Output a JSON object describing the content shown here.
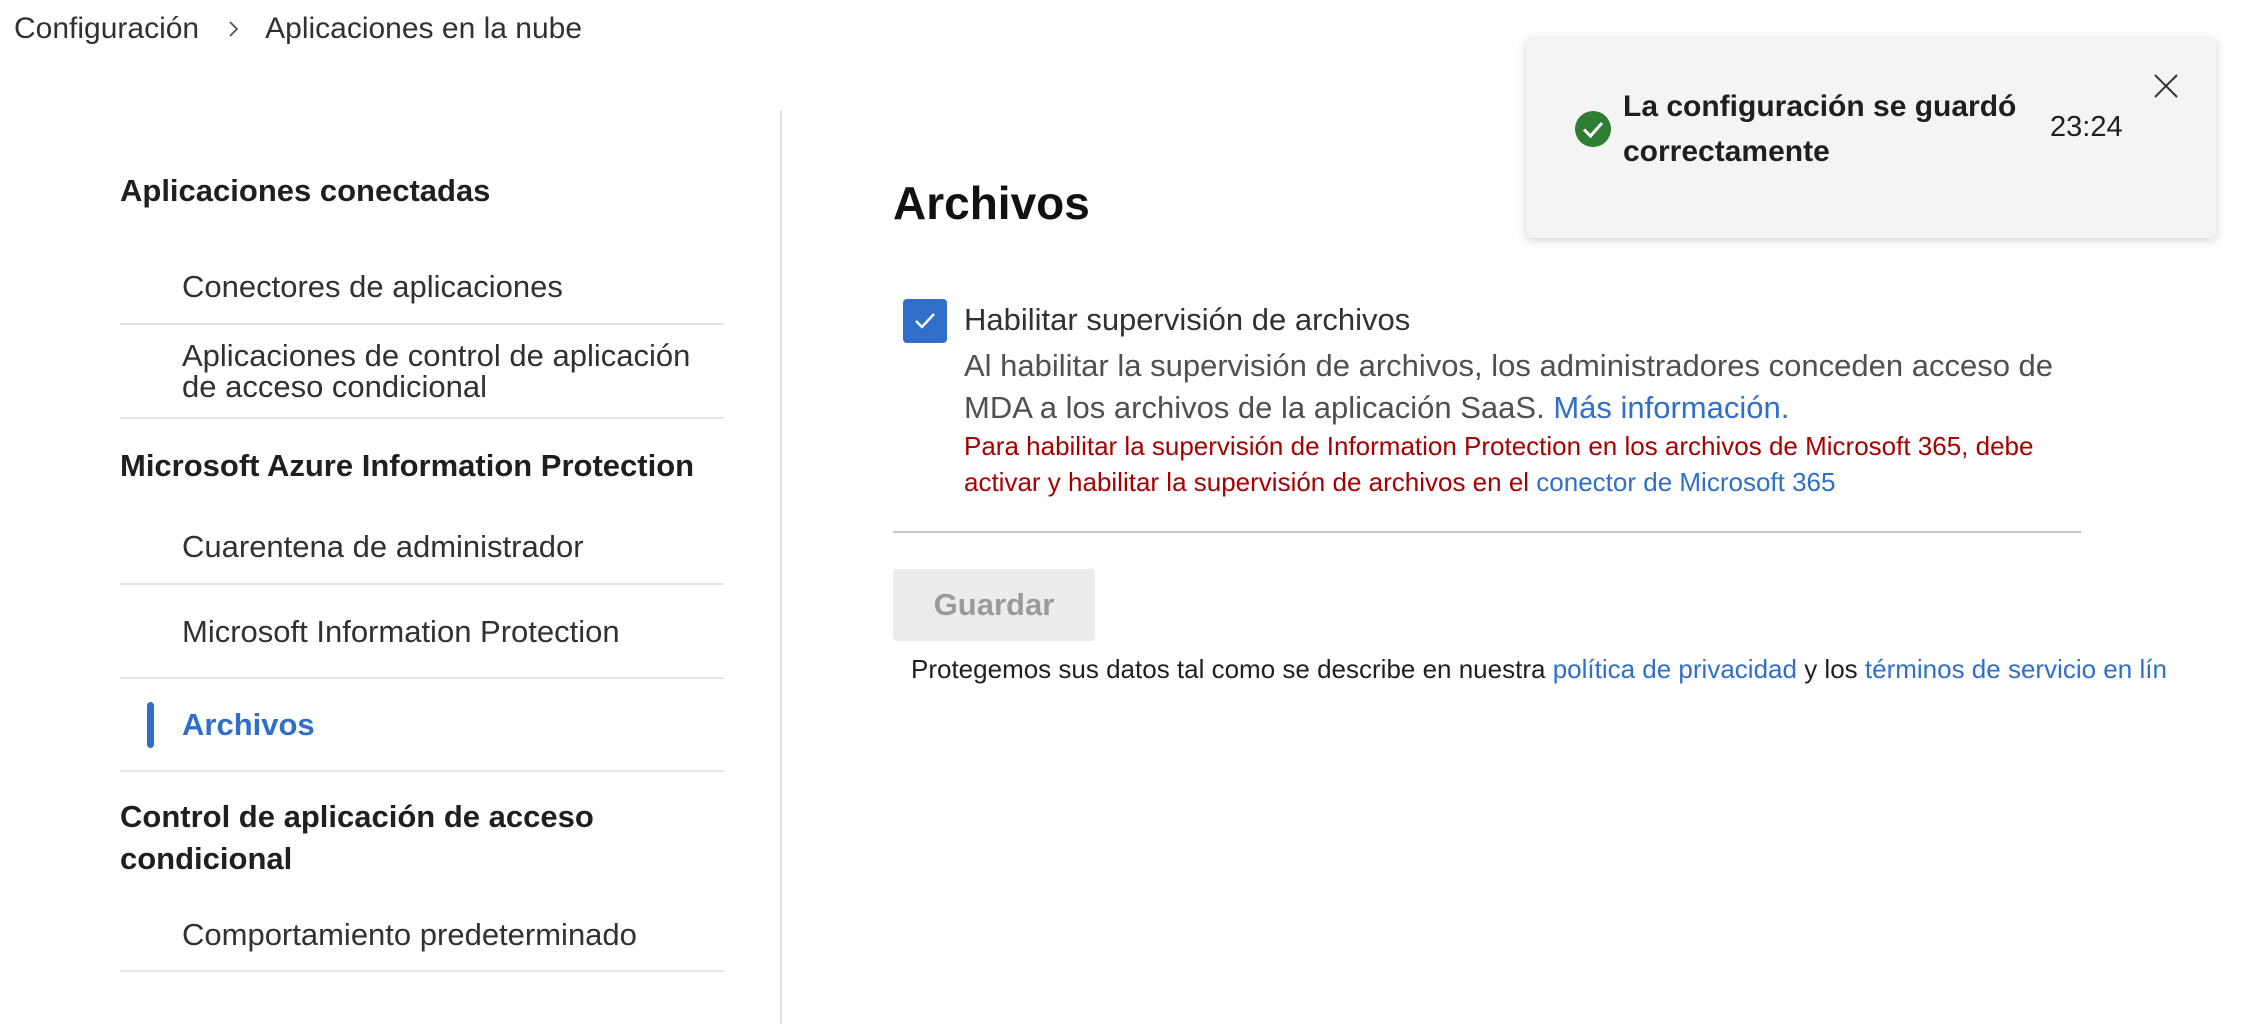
{
  "breadcrumb": {
    "root": "Configuración",
    "current": "Aplicaciones en la nube"
  },
  "nav": {
    "section1_title": "Aplicaciones conectadas",
    "item_connectors": "Conectores de aplicaciones",
    "item_conditional_apps_line1": "Aplicaciones de control de aplicación",
    "item_conditional_apps_line2": "de acceso condicional",
    "section2_title": "Microsoft Azure Information Protection",
    "item_quarantine": "Cuarentena de administrador",
    "item_mip": "Microsoft Information Protection",
    "item_files": "Archivos",
    "section3_title_line1": "Control de aplicación de acceso",
    "section3_title_line2": "condicional",
    "item_default_behavior": "Comportamiento predeterminado"
  },
  "main": {
    "title": "Archivos",
    "checkbox_checked": true,
    "checkbox_label": "Habilitar supervisión de archivos",
    "description": "Al habilitar la supervisión de archivos, los administradores conceden acceso de MDA a los archivos de la aplicación SaaS.",
    "more_info_link": "Más información.",
    "warning": "Para habilitar la supervisión de Information Protection en los archivos de Microsoft 365, debe activar y habilitar la supervisión de archivos en el",
    "warning_link": "conector de Microsoft 365",
    "save_label": "Guardar",
    "privacy_prefix": "Protegemos sus datos tal como se describe en nuestra",
    "privacy_link": "política de privacidad",
    "privacy_middle": "y los",
    "terms_link": "términos de servicio en lín"
  },
  "toast": {
    "message": "La configuración se guardó correctamente",
    "time": "23:24"
  },
  "colors": {
    "accent": "#2f6fc9",
    "success": "#2e7d32",
    "warning_text": "#a80000"
  },
  "icons": {
    "breadcrumb_separator": "chevron-right-icon",
    "checkbox": "checkmark-icon",
    "toast_status": "success-circle-icon",
    "toast_close": "close-icon"
  }
}
